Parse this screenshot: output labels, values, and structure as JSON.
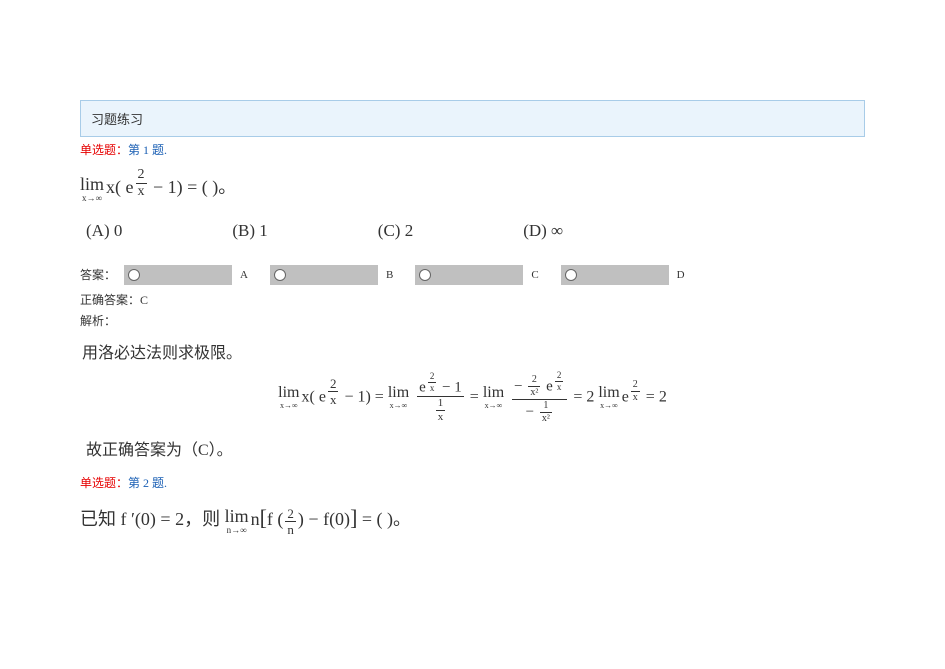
{
  "header": {
    "title": "习题练习"
  },
  "q1": {
    "type_label": "单选题：",
    "number_label": "第 1 题.",
    "stem_prefix": "lim",
    "stem_sub": "x→∞",
    "stem_body": "x( e",
    "stem_exp_num": "2",
    "stem_exp_den": "x",
    "stem_tail": " − 1) = (        )。",
    "options": {
      "A": "(A) 0",
      "B": "(B) 1",
      "C": "(C) 2",
      "D": "(D) ∞"
    },
    "answer_label": "答案：",
    "opt_A": "A",
    "opt_B": "B",
    "opt_C": "C",
    "opt_D": "D",
    "correct_label": "正确答案：C",
    "analysis_label": "解析：",
    "explain_text": "用洛必达法则求极限。",
    "work": {
      "lim": "lim",
      "sub": "x→∞",
      "p1_a": "x( e",
      "p1_exp_num": "2",
      "p1_exp_den": "x",
      "p1_b": " − 1)  =  ",
      "p2_num": "e   − 1",
      "p2_num_exp_n": "2",
      "p2_num_exp_d": "x",
      "p2_den_num": "1",
      "p2_den_den": "x",
      "eq": "  =  ",
      "p3_num_a": "− ",
      "p3_num_frac_n": "2",
      "p3_num_frac_d": "x²",
      "p3_num_b": " e",
      "p3_num_exp_n": "2",
      "p3_num_exp_d": "x",
      "p3_den_a": "− ",
      "p3_den_frac_n": "1",
      "p3_den_frac_d": "x²",
      "p4": "  =  2 ",
      "p4_lim": "lim",
      "p4_sub": "x→∞",
      "p4_e": "e",
      "p4_exp_n": "2",
      "p4_exp_d": "x",
      "p5": "  =  2"
    },
    "conclude": "故正确答案为（C）。"
  },
  "q2": {
    "type_label": "单选题：",
    "number_label": "第 2 题.",
    "stem_a": "已知 f ′(0) = 2，则",
    "lim": "lim",
    "sub": "n→∞",
    "stem_b": "n",
    "bracket_open": "[",
    "f_open": "f (",
    "frac_num": "2",
    "frac_den": "n",
    "f_close": ")",
    "minus": " − f(0)",
    "bracket_close": "]",
    "tail": " = (        )。"
  }
}
